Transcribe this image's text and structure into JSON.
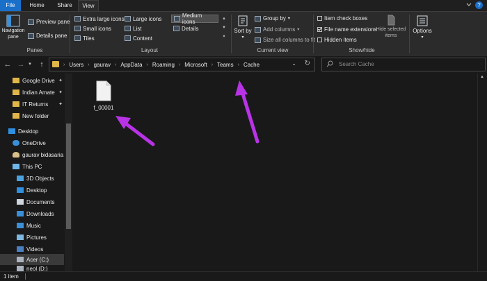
{
  "tabs": {
    "file": "File",
    "home": "Home",
    "share": "Share",
    "view": "View"
  },
  "help_label": "?",
  "ribbon": {
    "panes": {
      "navigation_pane": "Navigation pane",
      "preview_pane": "Preview pane",
      "details_pane": "Details pane",
      "group_label": "Panes"
    },
    "layout": {
      "extra_large_icons": "Extra large icons",
      "large_icons": "Large icons",
      "medium_icons": "Medium icons",
      "small_icons": "Small icons",
      "list": "List",
      "details": "Details",
      "tiles": "Tiles",
      "content": "Content",
      "selected": "Medium icons",
      "group_label": "Layout"
    },
    "current_view": {
      "sort_by": "Sort by",
      "group_by": "Group by",
      "add_columns": "Add columns",
      "size_all_columns": "Size all columns to fit",
      "group_label": "Current view"
    },
    "show_hide": {
      "item_check_boxes": "Item check boxes",
      "item_check_boxes_checked": false,
      "file_name_extensions": "File name extensions",
      "file_name_extensions_checked": true,
      "hidden_items": "Hidden items",
      "hidden_items_checked": false,
      "hide_selected_items": "Hide selected items",
      "options": "Options",
      "group_label": "Show/hide"
    }
  },
  "address_bar": {
    "crumbs": [
      "Users",
      "gaurav",
      "AppData",
      "Roaming",
      "Microsoft",
      "Teams",
      "Cache"
    ],
    "search_placeholder": "Search Cache"
  },
  "nav_pane": {
    "items": [
      {
        "label": "Google Drive",
        "icon": "google-drive-folder-icon",
        "pinned": true
      },
      {
        "label": "Indian Amate",
        "icon": "folder-icon",
        "pinned": true
      },
      {
        "label": "IT Returns",
        "icon": "folder-icon",
        "pinned": true
      },
      {
        "label": "New folder",
        "icon": "folder-icon",
        "pinned": false
      },
      {
        "label": "Desktop",
        "icon": "desktop-icon",
        "pinned": false
      },
      {
        "label": "OneDrive",
        "icon": "onedrive-icon",
        "pinned": false
      },
      {
        "label": "gaurav bidasaria",
        "icon": "user-icon",
        "pinned": false
      },
      {
        "label": "This PC",
        "icon": "pc-icon",
        "pinned": false
      },
      {
        "label": "3D Objects",
        "icon": "3d-objects-icon",
        "pinned": false
      },
      {
        "label": "Desktop",
        "icon": "desktop-icon",
        "pinned": false
      },
      {
        "label": "Documents",
        "icon": "documents-icon",
        "pinned": false
      },
      {
        "label": "Downloads",
        "icon": "downloads-icon",
        "pinned": false
      },
      {
        "label": "Music",
        "icon": "music-icon",
        "pinned": false
      },
      {
        "label": "Pictures",
        "icon": "pictures-icon",
        "pinned": false
      },
      {
        "label": "Videos",
        "icon": "videos-icon",
        "pinned": false
      },
      {
        "label": "Acer (C:)",
        "icon": "drive-icon",
        "pinned": false
      },
      {
        "label": "neol (D:)",
        "icon": "drive-icon",
        "pinned": false
      }
    ]
  },
  "content": {
    "files": [
      {
        "name": "f_00001",
        "icon": "file-icon"
      }
    ]
  },
  "status_bar": {
    "item_count": "1 item"
  },
  "colors": {
    "accent": "#1a6fc9",
    "background": "#191919",
    "ribbon": "#2b2b2b",
    "annotation_arrow": "#b833e6"
  }
}
